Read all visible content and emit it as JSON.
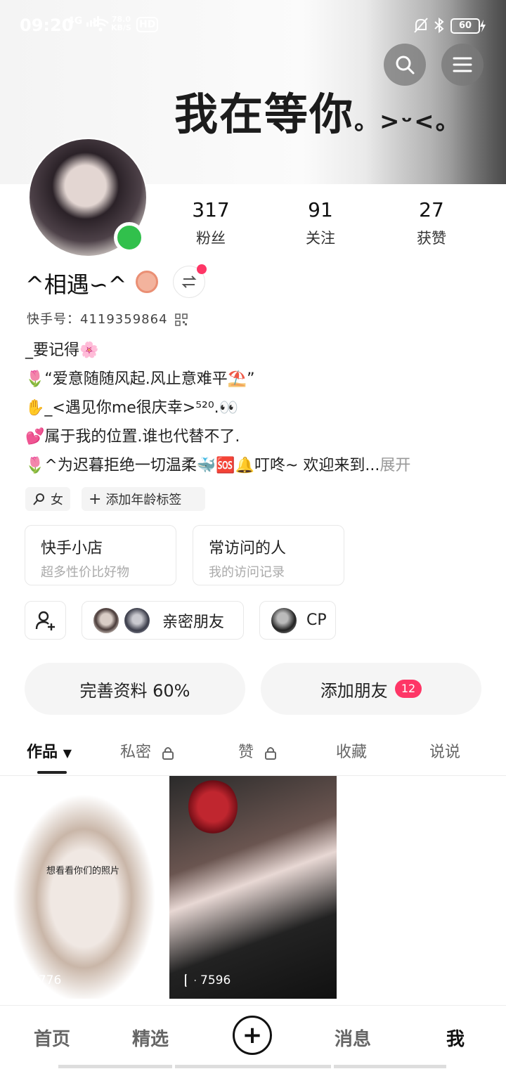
{
  "status_bar": {
    "time": "09:20",
    "network": "4G",
    "speed_value": "78.0",
    "speed_unit": "KB/S",
    "hd": "HD",
    "battery": "60"
  },
  "banner": {
    "text": "我在等你",
    "text_suffix": "。>ᵕ<。"
  },
  "profile": {
    "stats": [
      {
        "value": "317",
        "label": "粉丝"
      },
      {
        "value": "91",
        "label": "关注"
      },
      {
        "value": "27",
        "label": "获赞"
      }
    ],
    "username": "^相遇∽^",
    "kuaishou_id": "快手号：4119359864",
    "bio_lines": [
      "_要记得🌸",
      "🌷“爱意随随风起.风止意难平⛱️”",
      "✋_<遇见你me很庆幸>⁵²⁰.👀",
      "💕属于我的位置.谁也代替不了.",
      "🌷^为迟暮拒绝一切温柔🐳🆘🔔叮咚~ 欢迎来到..."
    ],
    "bio_more": "展开",
    "tags": [
      "女",
      "添加年龄标签"
    ],
    "cards": [
      {
        "title": "快手小店",
        "subtitle": "超多性价比好物"
      },
      {
        "title": "常访问的人",
        "subtitle": "我的访问记录"
      }
    ],
    "close_friends_label": "亲密朋友",
    "cp_label": "CP",
    "complete_profile": "完善资料 60%",
    "add_friends": "添加朋友",
    "add_friends_count": "12"
  },
  "tabs": [
    "作品",
    "私密",
    "赞",
    "收藏",
    "说说"
  ],
  "videos": [
    {
      "plays": "6776",
      "caption": "想看看你们的照片"
    },
    {
      "plays": "7596"
    }
  ],
  "bottom_nav": [
    "首页",
    "精选",
    "消息",
    "我"
  ],
  "colors": {
    "accent_red": "#fe3666",
    "online_green": "#31c04c"
  }
}
